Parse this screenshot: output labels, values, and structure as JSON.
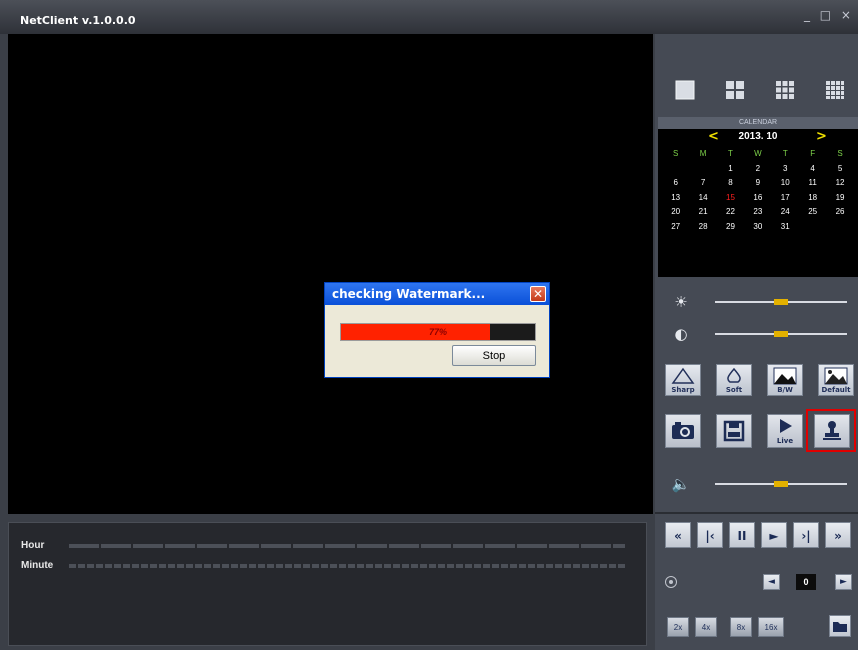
{
  "window": {
    "title": "NetClient v.1.0.0.0",
    "controls": "_ □ ×"
  },
  "timeline": {
    "hour_label": "Hour",
    "minute_label": "Minute"
  },
  "layouts": [
    "layout-1x1-icon",
    "layout-2x2-icon",
    "layout-3x3-icon",
    "layout-4x4-icon"
  ],
  "calendar": {
    "header": "CALENDAR",
    "month": "2013. 10",
    "prev": "<",
    "next": ">",
    "weekdays": [
      "S",
      "M",
      "T",
      "W",
      "T",
      "F",
      "S"
    ],
    "days": [
      "",
      "",
      "1",
      "2",
      "3",
      "4",
      "5",
      "6",
      "7",
      "8",
      "9",
      "10",
      "11",
      "12",
      "13",
      "14",
      "15",
      "16",
      "17",
      "18",
      "19",
      "20",
      "21",
      "22",
      "23",
      "24",
      "25",
      "26",
      "27",
      "28",
      "29",
      "30",
      "31"
    ],
    "today": "15"
  },
  "sliders": {
    "brightness": {
      "icon": "brightness-icon",
      "value": 0.5
    },
    "contrast": {
      "icon": "contrast-icon",
      "value": 0.5
    },
    "volume": {
      "icon": "speaker-icon",
      "value": 0.5
    }
  },
  "image_buttons": {
    "sharp": "Sharp",
    "soft": "Soft",
    "bw": "B/W",
    "default": "Default"
  },
  "action_buttons": {
    "snapshot": "camera-icon",
    "save": "floppy-disk-icon",
    "live": "Live",
    "watermark": "stamp-icon"
  },
  "playback": [
    "«",
    "|‹",
    "II",
    "►",
    "›|",
    "»"
  ],
  "frame": {
    "value": "0"
  },
  "speeds": [
    "2x",
    "4x",
    "8x",
    "16x"
  ],
  "dialog": {
    "title": "checking Watermark...",
    "progress_text": "77%",
    "progress": 0.77,
    "stop_label": "Stop"
  },
  "colors": {
    "accent": "#e3b100",
    "today": "#ff2020",
    "progress": "#ff2200",
    "dialog_title": "#0a50d8"
  }
}
